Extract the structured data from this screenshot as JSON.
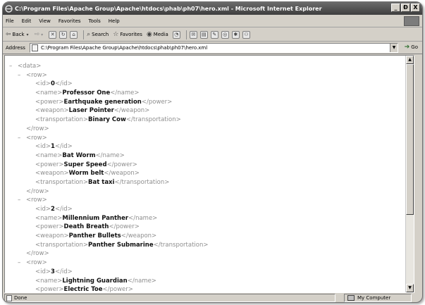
{
  "window": {
    "title": "C:\\Program Files\\Apache Group\\Apache\\htdocs\\phab\\ph07\\hero.xml - Microsoft Internet Explorer",
    "min_glyph": "_",
    "max_glyph": "Ð",
    "close_glyph": "X"
  },
  "menu": {
    "items": [
      "File",
      "Edit",
      "View",
      "Favorites",
      "Tools",
      "Help"
    ]
  },
  "toolbar": {
    "back_label": "Back",
    "search_label": "Search",
    "favorites_label": "Favorites",
    "media_label": "Media"
  },
  "address": {
    "label": "Address",
    "value": "C:\\Program Files\\Apache Group\\Apache\\htdocs\\phab\\ph07\\hero.xml",
    "go_label": "Go"
  },
  "xml": {
    "data_open": "<data>",
    "row_open": "<row>",
    "row_close": "</row>",
    "rows": [
      {
        "id_open": "<id>",
        "id": "0",
        "id_close": "</id>",
        "name_open": "<name>",
        "name": "Professor One",
        "name_close": "</name>",
        "power_open": "<power>",
        "power": "Earthquake generation",
        "power_close": "</power>",
        "weapon_open": "<weapon>",
        "weapon": "Laser Pointer",
        "weapon_close": "</weapon>",
        "transport_open": "<transportation>",
        "transport": "Binary Cow",
        "transport_close": "</transportation>"
      },
      {
        "id_open": "<id>",
        "id": "1",
        "id_close": "</id>",
        "name_open": "<name>",
        "name": "Bat Worm",
        "name_close": "</name>",
        "power_open": "<power>",
        "power": "Super Speed",
        "power_close": "</power>",
        "weapon_open": "<weapon>",
        "weapon": "Worm belt",
        "weapon_close": "</weapon>",
        "transport_open": "<transportation>",
        "transport": "Bat taxi",
        "transport_close": "</transportation>"
      },
      {
        "id_open": "<id>",
        "id": "2",
        "id_close": "</id>",
        "name_open": "<name>",
        "name": "Millennium Panther",
        "name_close": "</name>",
        "power_open": "<power>",
        "power": "Death Breath",
        "power_close": "</power>",
        "weapon_open": "<weapon>",
        "weapon": "Panther Bullets",
        "weapon_close": "</weapon>",
        "transport_open": "<transportation>",
        "transport": "Panther Submarine",
        "transport_close": "</transportation>"
      },
      {
        "id_open": "<id>",
        "id": "3",
        "id_close": "</id>",
        "name_open": "<name>",
        "name": "Lightning Guardian",
        "name_close": "</name>",
        "power_open": "<power>",
        "power": "Electric Toe",
        "power_close": "</power>"
      }
    ]
  },
  "status": {
    "text": "Done",
    "zone": "My Computer"
  }
}
